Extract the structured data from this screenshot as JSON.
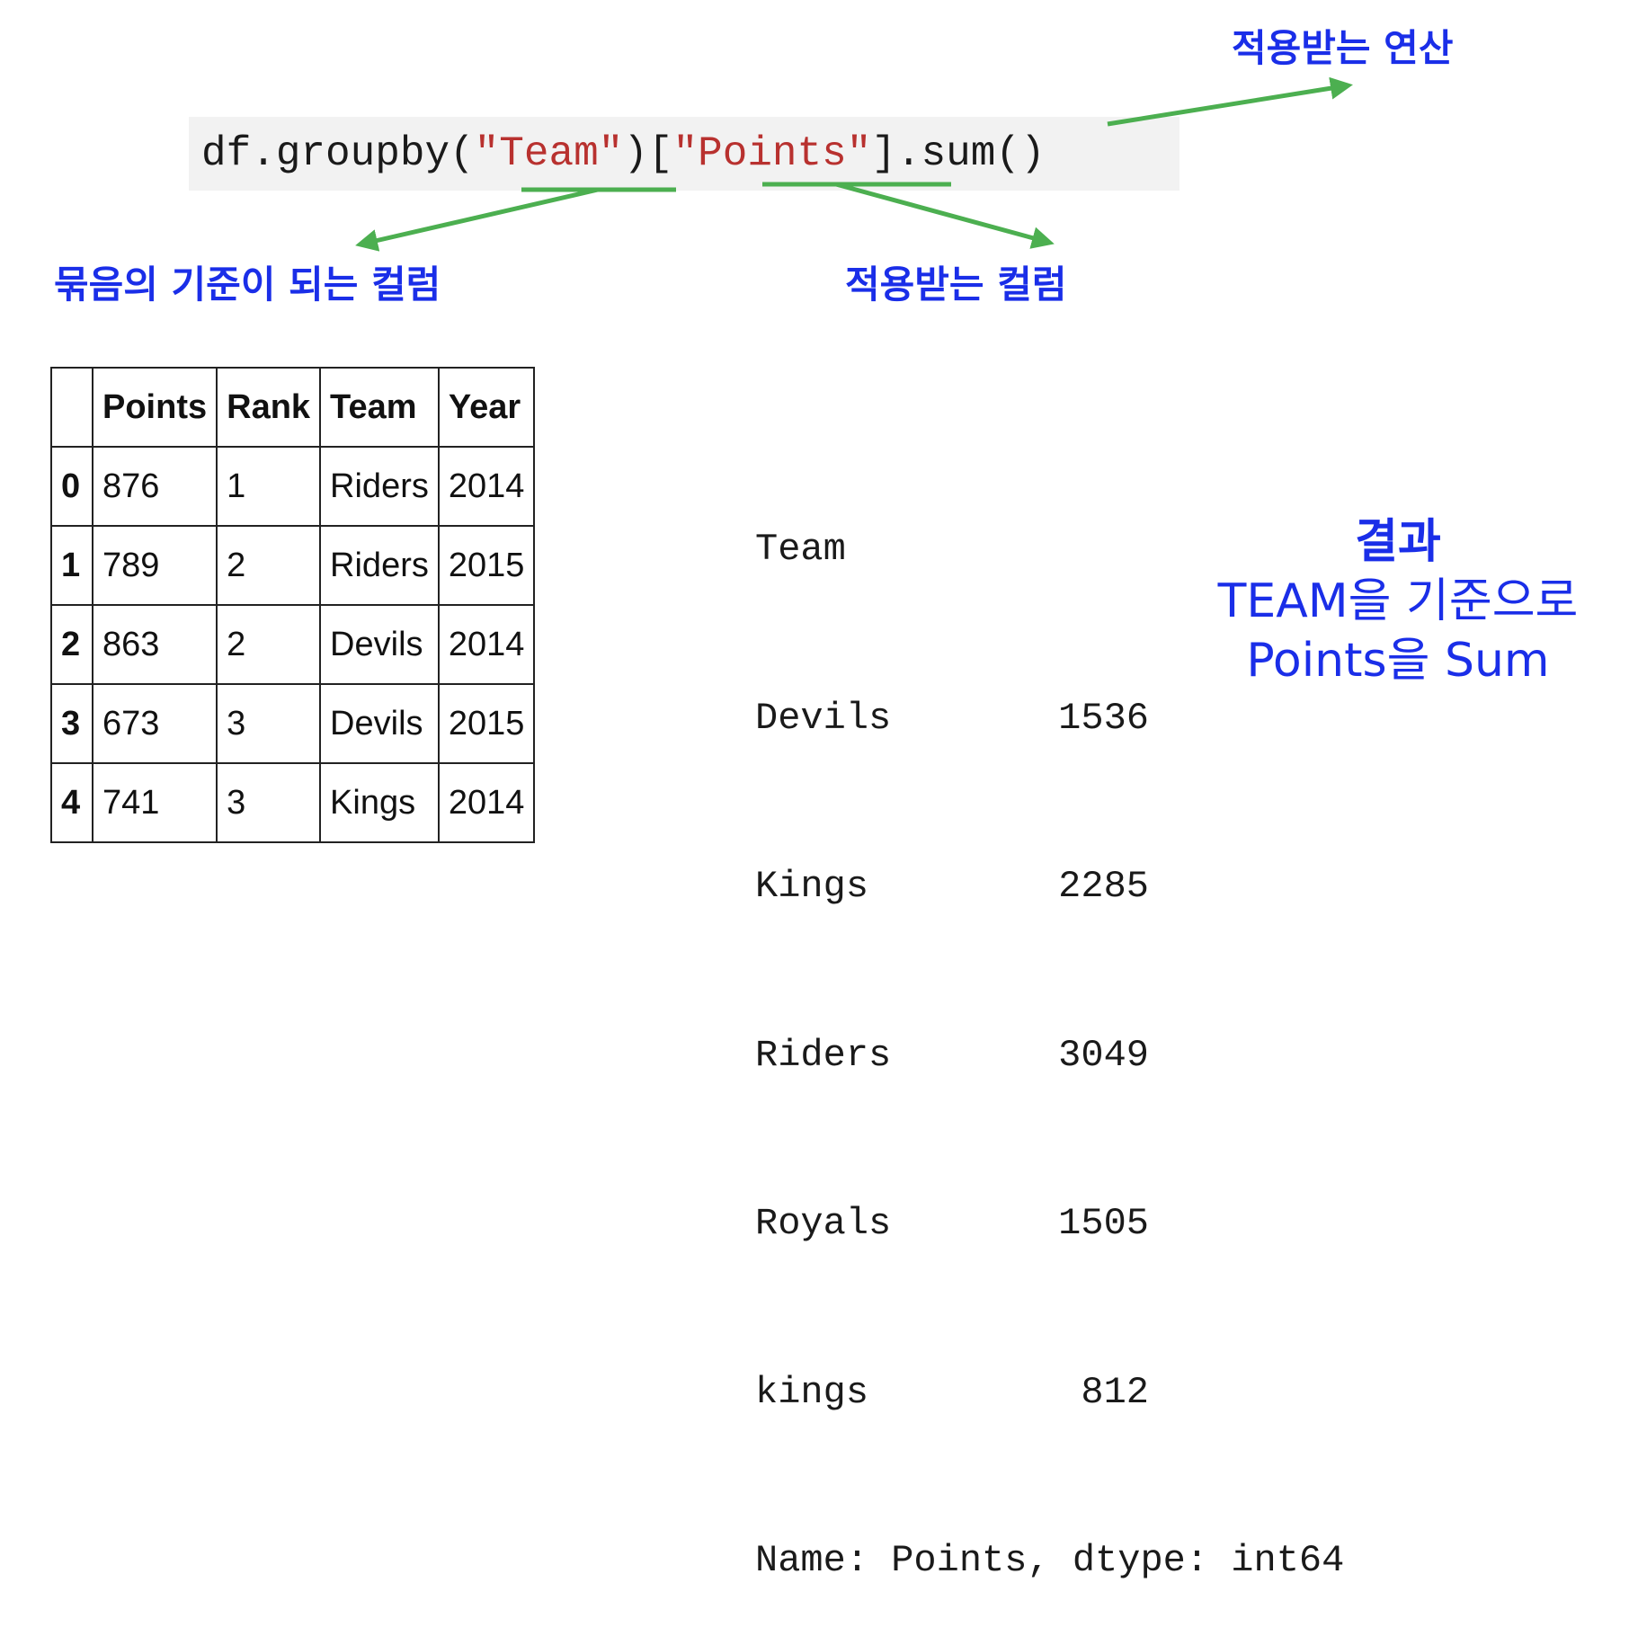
{
  "code": {
    "prefix": "df.groupby(",
    "group_col": "\"Team\"",
    "mid": ")[",
    "applied_col": "\"Points\"",
    "suffix": "].sum()"
  },
  "annotations": {
    "operation": "적용받는 연산",
    "group_column": "묶음의 기준이 되는 컬럼",
    "applied_column": "적용받는 컬럼"
  },
  "colors": {
    "annotation": "#1a2ee8",
    "arrow": "#4caf50",
    "string": "#b8312f"
  },
  "table": {
    "headers": [
      "",
      "Points",
      "Rank",
      "Team",
      "Year"
    ],
    "rows": [
      {
        "index": "0",
        "points": "876",
        "rank": "1",
        "team": "Riders",
        "year": "2014"
      },
      {
        "index": "1",
        "points": "789",
        "rank": "2",
        "team": "Riders",
        "year": "2015"
      },
      {
        "index": "2",
        "points": "863",
        "rank": "2",
        "team": "Devils",
        "year": "2014"
      },
      {
        "index": "3",
        "points": "673",
        "rank": "3",
        "team": "Devils",
        "year": "2015"
      },
      {
        "index": "4",
        "points": "741",
        "rank": "3",
        "team": "Kings",
        "year": "2014"
      }
    ]
  },
  "output": {
    "header": "Team",
    "rows": [
      {
        "name": "Devils",
        "value": "1536"
      },
      {
        "name": "Kings",
        "value": "2285"
      },
      {
        "name": "Riders",
        "value": "3049"
      },
      {
        "name": "Royals",
        "value": "1505"
      },
      {
        "name": "kings",
        "value": "812"
      }
    ],
    "footer": "Name: Points, dtype: int64"
  },
  "result_note": {
    "line1": "결과",
    "line2": "TEAM을 기준으로",
    "line3": "Points을 Sum"
  }
}
